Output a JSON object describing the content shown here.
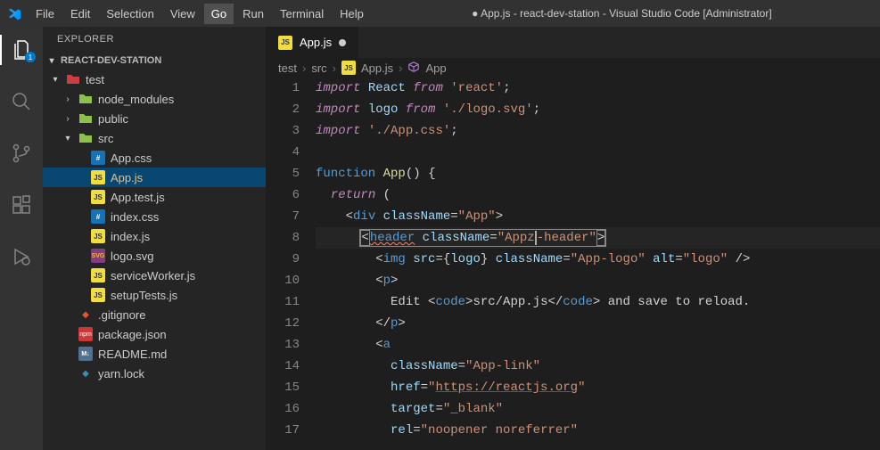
{
  "window_title": "● App.js - react-dev-station - Visual Studio Code [Administrator]",
  "menu": [
    "File",
    "Edit",
    "Selection",
    "View",
    "Go",
    "Run",
    "Terminal",
    "Help"
  ],
  "active_menu": "Go",
  "activitybar": {
    "badge": "1"
  },
  "sidebar": {
    "header": "EXPLORER",
    "project": "REACT-DEV-STATION",
    "tree": [
      {
        "type": "folder",
        "label": "test",
        "depth": 0,
        "open": true,
        "iconStyle": "red"
      },
      {
        "type": "folder",
        "label": "node_modules",
        "depth": 1,
        "open": false,
        "iconStyle": "green"
      },
      {
        "type": "folder",
        "label": "public",
        "depth": 1,
        "open": false,
        "iconStyle": "green"
      },
      {
        "type": "folder",
        "label": "src",
        "depth": 1,
        "open": true,
        "iconStyle": "green"
      },
      {
        "type": "file",
        "label": "App.css",
        "depth": 2,
        "icon": "css"
      },
      {
        "type": "file",
        "label": "App.js",
        "depth": 2,
        "icon": "js",
        "selected": true,
        "modified": true
      },
      {
        "type": "file",
        "label": "App.test.js",
        "depth": 2,
        "icon": "js"
      },
      {
        "type": "file",
        "label": "index.css",
        "depth": 2,
        "icon": "css"
      },
      {
        "type": "file",
        "label": "index.js",
        "depth": 2,
        "icon": "js"
      },
      {
        "type": "file",
        "label": "logo.svg",
        "depth": 2,
        "icon": "svg"
      },
      {
        "type": "file",
        "label": "serviceWorker.js",
        "depth": 2,
        "icon": "js"
      },
      {
        "type": "file",
        "label": "setupTests.js",
        "depth": 2,
        "icon": "js"
      },
      {
        "type": "file",
        "label": ".gitignore",
        "depth": 1,
        "icon": "git"
      },
      {
        "type": "file",
        "label": "package.json",
        "depth": 1,
        "icon": "npm"
      },
      {
        "type": "file",
        "label": "README.md",
        "depth": 1,
        "icon": "md"
      },
      {
        "type": "file",
        "label": "yarn.lock",
        "depth": 1,
        "icon": "yarn"
      }
    ]
  },
  "tab": {
    "icon": "JS",
    "label": "App.js",
    "dirty": true
  },
  "breadcrumbs": [
    "test",
    "src",
    "App.js",
    "App"
  ],
  "breadcrumb_icons": [
    "",
    "",
    "JS",
    "cube"
  ],
  "code": {
    "start_line": 1,
    "lines": [
      {
        "n": 1,
        "tokens": [
          [
            "tok-kw-imp",
            "import"
          ],
          [
            "",
            " "
          ],
          [
            "tok-var",
            "React"
          ],
          [
            "",
            " "
          ],
          [
            "tok-kw-imp",
            "from"
          ],
          [
            "",
            " "
          ],
          [
            "tok-str",
            "'react'"
          ],
          [
            "",
            ";"
          ]
        ]
      },
      {
        "n": 2,
        "tokens": [
          [
            "tok-kw-imp",
            "import"
          ],
          [
            "",
            " "
          ],
          [
            "tok-var",
            "logo"
          ],
          [
            "",
            " "
          ],
          [
            "tok-kw-imp",
            "from"
          ],
          [
            "",
            " "
          ],
          [
            "tok-str",
            "'./logo.svg'"
          ],
          [
            "",
            ";"
          ]
        ]
      },
      {
        "n": 3,
        "tokens": [
          [
            "tok-kw-imp",
            "import"
          ],
          [
            "",
            " "
          ],
          [
            "tok-str",
            "'./App.css'"
          ],
          [
            "",
            ";"
          ]
        ]
      },
      {
        "n": 4,
        "tokens": [
          [
            "",
            ""
          ]
        ]
      },
      {
        "n": 5,
        "tokens": [
          [
            "tok-fn-kw",
            "function"
          ],
          [
            "",
            " "
          ],
          [
            "tok-fn-name",
            "App"
          ],
          [
            "",
            "()"
          ],
          [
            "",
            " "
          ],
          [
            "tok-brace",
            "{"
          ]
        ]
      },
      {
        "n": 6,
        "tokens": [
          [
            "",
            "  "
          ],
          [
            "tok-kw",
            "return"
          ],
          [
            "",
            " ("
          ]
        ]
      },
      {
        "n": 7,
        "tokens": [
          [
            "",
            "    <"
          ],
          [
            "tok-tag",
            "div"
          ],
          [
            "",
            " "
          ],
          [
            "tok-attr",
            "className"
          ],
          [
            "",
            "="
          ],
          [
            "tok-str",
            "\"App\""
          ],
          [
            "",
            ">"
          ]
        ]
      },
      {
        "n": 8,
        "hl": true,
        "special": "header-line"
      },
      {
        "n": 9,
        "tokens": [
          [
            "",
            "        <"
          ],
          [
            "tok-tag",
            "img"
          ],
          [
            "",
            " "
          ],
          [
            "tok-attr",
            "src"
          ],
          [
            "",
            "="
          ],
          [
            "tok-brace",
            "{"
          ],
          [
            "tok-var",
            "logo"
          ],
          [
            "tok-brace",
            "}"
          ],
          [
            "",
            " "
          ],
          [
            "tok-attr",
            "className"
          ],
          [
            "",
            "="
          ],
          [
            "tok-str",
            "\"App-logo\""
          ],
          [
            "",
            " "
          ],
          [
            "tok-attr",
            "alt"
          ],
          [
            "",
            "="
          ],
          [
            "tok-str",
            "\"logo\""
          ],
          [
            "",
            " />"
          ]
        ]
      },
      {
        "n": 10,
        "tokens": [
          [
            "",
            "        <"
          ],
          [
            "tok-tag",
            "p"
          ],
          [
            "",
            ">"
          ]
        ]
      },
      {
        "n": 11,
        "tokens": [
          [
            "",
            "          "
          ],
          [
            "tok-jsxtext",
            "Edit "
          ],
          [
            "",
            "<"
          ],
          [
            "tok-tag",
            "code"
          ],
          [
            "",
            ">"
          ],
          [
            "tok-jsxtext",
            "src/App.js"
          ],
          [
            "",
            "</"
          ],
          [
            "tok-tag",
            "code"
          ],
          [
            "",
            ">"
          ],
          [
            "tok-jsxtext",
            " and save to reload."
          ]
        ]
      },
      {
        "n": 12,
        "tokens": [
          [
            "",
            "        </"
          ],
          [
            "tok-tag",
            "p"
          ],
          [
            "",
            ">"
          ]
        ]
      },
      {
        "n": 13,
        "tokens": [
          [
            "",
            "        <"
          ],
          [
            "tok-tag",
            "a"
          ]
        ]
      },
      {
        "n": 14,
        "tokens": [
          [
            "",
            "          "
          ],
          [
            "tok-attr",
            "className"
          ],
          [
            "",
            "="
          ],
          [
            "tok-str",
            "\"App-link\""
          ]
        ]
      },
      {
        "n": 15,
        "tokens": [
          [
            "",
            "          "
          ],
          [
            "tok-attr",
            "href"
          ],
          [
            "",
            "="
          ],
          [
            "tok-str",
            "\""
          ],
          [
            "tok-link",
            "https://reactjs.org"
          ],
          [
            "tok-str",
            "\""
          ]
        ]
      },
      {
        "n": 16,
        "tokens": [
          [
            "",
            "          "
          ],
          [
            "tok-attr",
            "target"
          ],
          [
            "",
            "="
          ],
          [
            "tok-str",
            "\"_blank\""
          ]
        ]
      },
      {
        "n": 17,
        "tokens": [
          [
            "",
            "          "
          ],
          [
            "tok-attr",
            "rel"
          ],
          [
            "",
            "="
          ],
          [
            "tok-str",
            "\"noopener noreferrer\""
          ]
        ]
      }
    ],
    "header_line": {
      "indent": "      ",
      "box_open": "<",
      "tag": "header",
      "attr": "className",
      "eq": "=",
      "str_open": "\"",
      "val_pre": "Appz",
      "val_post": "-header",
      "str_close": "\"",
      "box_close": ">"
    }
  }
}
